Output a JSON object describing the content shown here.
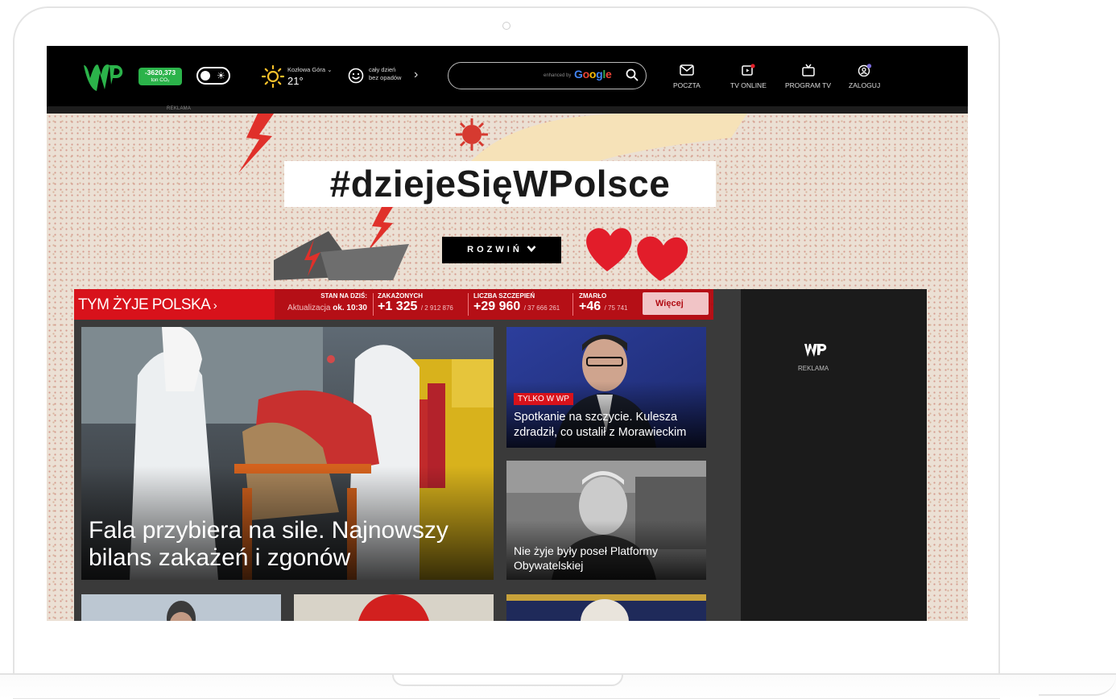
{
  "topbar": {
    "co2_value": "-3620,373",
    "co2_unit": "ton CO₂",
    "weather_location": "Kozłowa Góra",
    "weather_temp": "21°",
    "forecast_line1": "cały dzień",
    "forecast_line2": "bez opadów",
    "search_placeholder": "",
    "search_enhanced": "enhanced by",
    "search_google": "Google",
    "ad_label": "REKLAMA",
    "nav": [
      {
        "label": "POCZTA"
      },
      {
        "label": "TV ONLINE"
      },
      {
        "label": "PROGRAM TV"
      },
      {
        "label": "ZALOGUJ"
      }
    ]
  },
  "banner": {
    "title": "#dziejeSięWPolsce",
    "expand_label": "ROZWIŃ"
  },
  "section": {
    "heading": "TYM ŻYJE POLSKA",
    "stan_label": "STAN NA DZIŚ:",
    "update_label": "Aktualizacja",
    "update_time": "ok. 10:30",
    "stats": [
      {
        "label": "ZAKAŻONYCH",
        "value": "+1 325",
        "total": "/ 2 912 876"
      },
      {
        "label": "LICZBA SZCZEPIEŃ",
        "value": "+29 960",
        "total": "/ 37 666 261"
      },
      {
        "label": "ZMARŁO",
        "value": "+46",
        "total": "/ 75 741"
      }
    ],
    "more_label": "Więcej",
    "ad_label": "REKLAMA"
  },
  "articles": {
    "main": {
      "title": "Fala przybiera na sile. Najnowszy bilans zakażeń i zgonów"
    },
    "side1": {
      "tag": "TYLKO W WP",
      "title": "Spotkanie na szczycie. Kulesza zdradził, co ustalił z Morawieckim"
    },
    "side2": {
      "title": "Nie żyje były poseł Platformy Obywatelskiej"
    }
  },
  "colors": {
    "wp_green": "#2bb34a",
    "red": "#d8121b",
    "black": "#000000"
  }
}
